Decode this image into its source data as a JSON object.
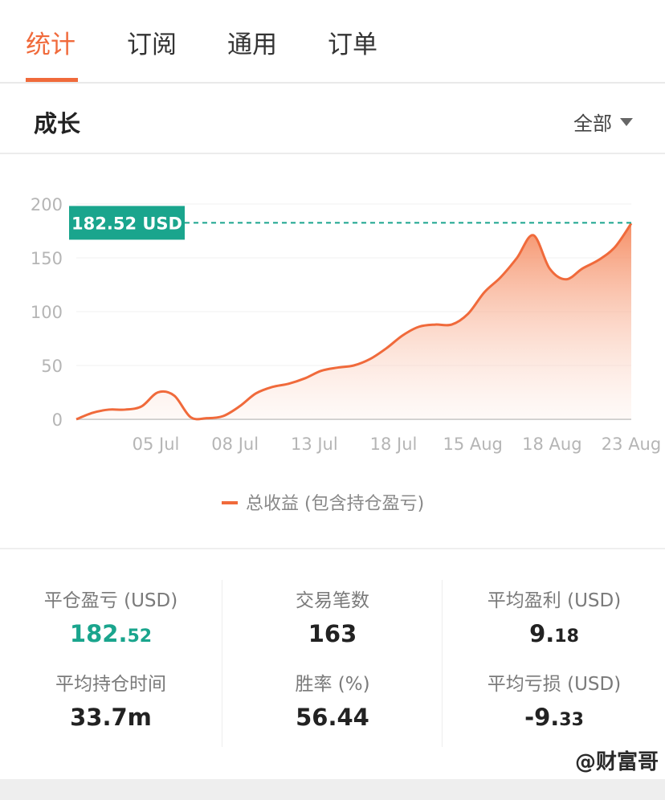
{
  "tabs": [
    {
      "label": "统计",
      "active": true
    },
    {
      "label": "订阅",
      "active": false
    },
    {
      "label": "通用",
      "active": false
    },
    {
      "label": "订单",
      "active": false
    }
  ],
  "section": {
    "title": "成长",
    "filter_label": "全部"
  },
  "colors": {
    "accent": "#f06a3b",
    "green": "#1aa58d"
  },
  "chart_data": {
    "type": "area",
    "x_tick_labels": [
      "05 Jul",
      "08 Jul",
      "13 Jul",
      "18 Jul",
      "15 Aug",
      "18 Aug",
      "23 Aug"
    ],
    "y_ticks": [
      "200",
      "150",
      "100",
      "50",
      "0"
    ],
    "ylim": [
      0,
      200
    ],
    "grid": true,
    "legend": "bottom-center",
    "series": [
      {
        "name": "总收益 (包含持仓盈亏)",
        "values": [
          0,
          6,
          9,
          9,
          12,
          25,
          22,
          2,
          1,
          3,
          12,
          24,
          30,
          33,
          38,
          45,
          48,
          50,
          56,
          66,
          78,
          86,
          88,
          88,
          98,
          118,
          132,
          150,
          171,
          140,
          130,
          140,
          148,
          160,
          182
        ]
      }
    ],
    "callout": {
      "label": "182.52 USD",
      "value": 182.52
    }
  },
  "stats": {
    "realized_pnl": {
      "label": "平仓盈亏 (USD)",
      "int": "182.",
      "dec": "52"
    },
    "trade_count": {
      "label": "交易笔数",
      "value": "163"
    },
    "avg_profit": {
      "label": "平均盈利 (USD)",
      "int": "9.",
      "dec": "18"
    },
    "avg_hold_time": {
      "label": "平均持仓时间",
      "value": "33.7m"
    },
    "win_rate": {
      "label": "胜率 (%)",
      "value": "56.44"
    },
    "avg_loss": {
      "label": "平均亏损 (USD)",
      "int": "-9.",
      "dec": "33"
    }
  },
  "watermark": "@财富哥"
}
